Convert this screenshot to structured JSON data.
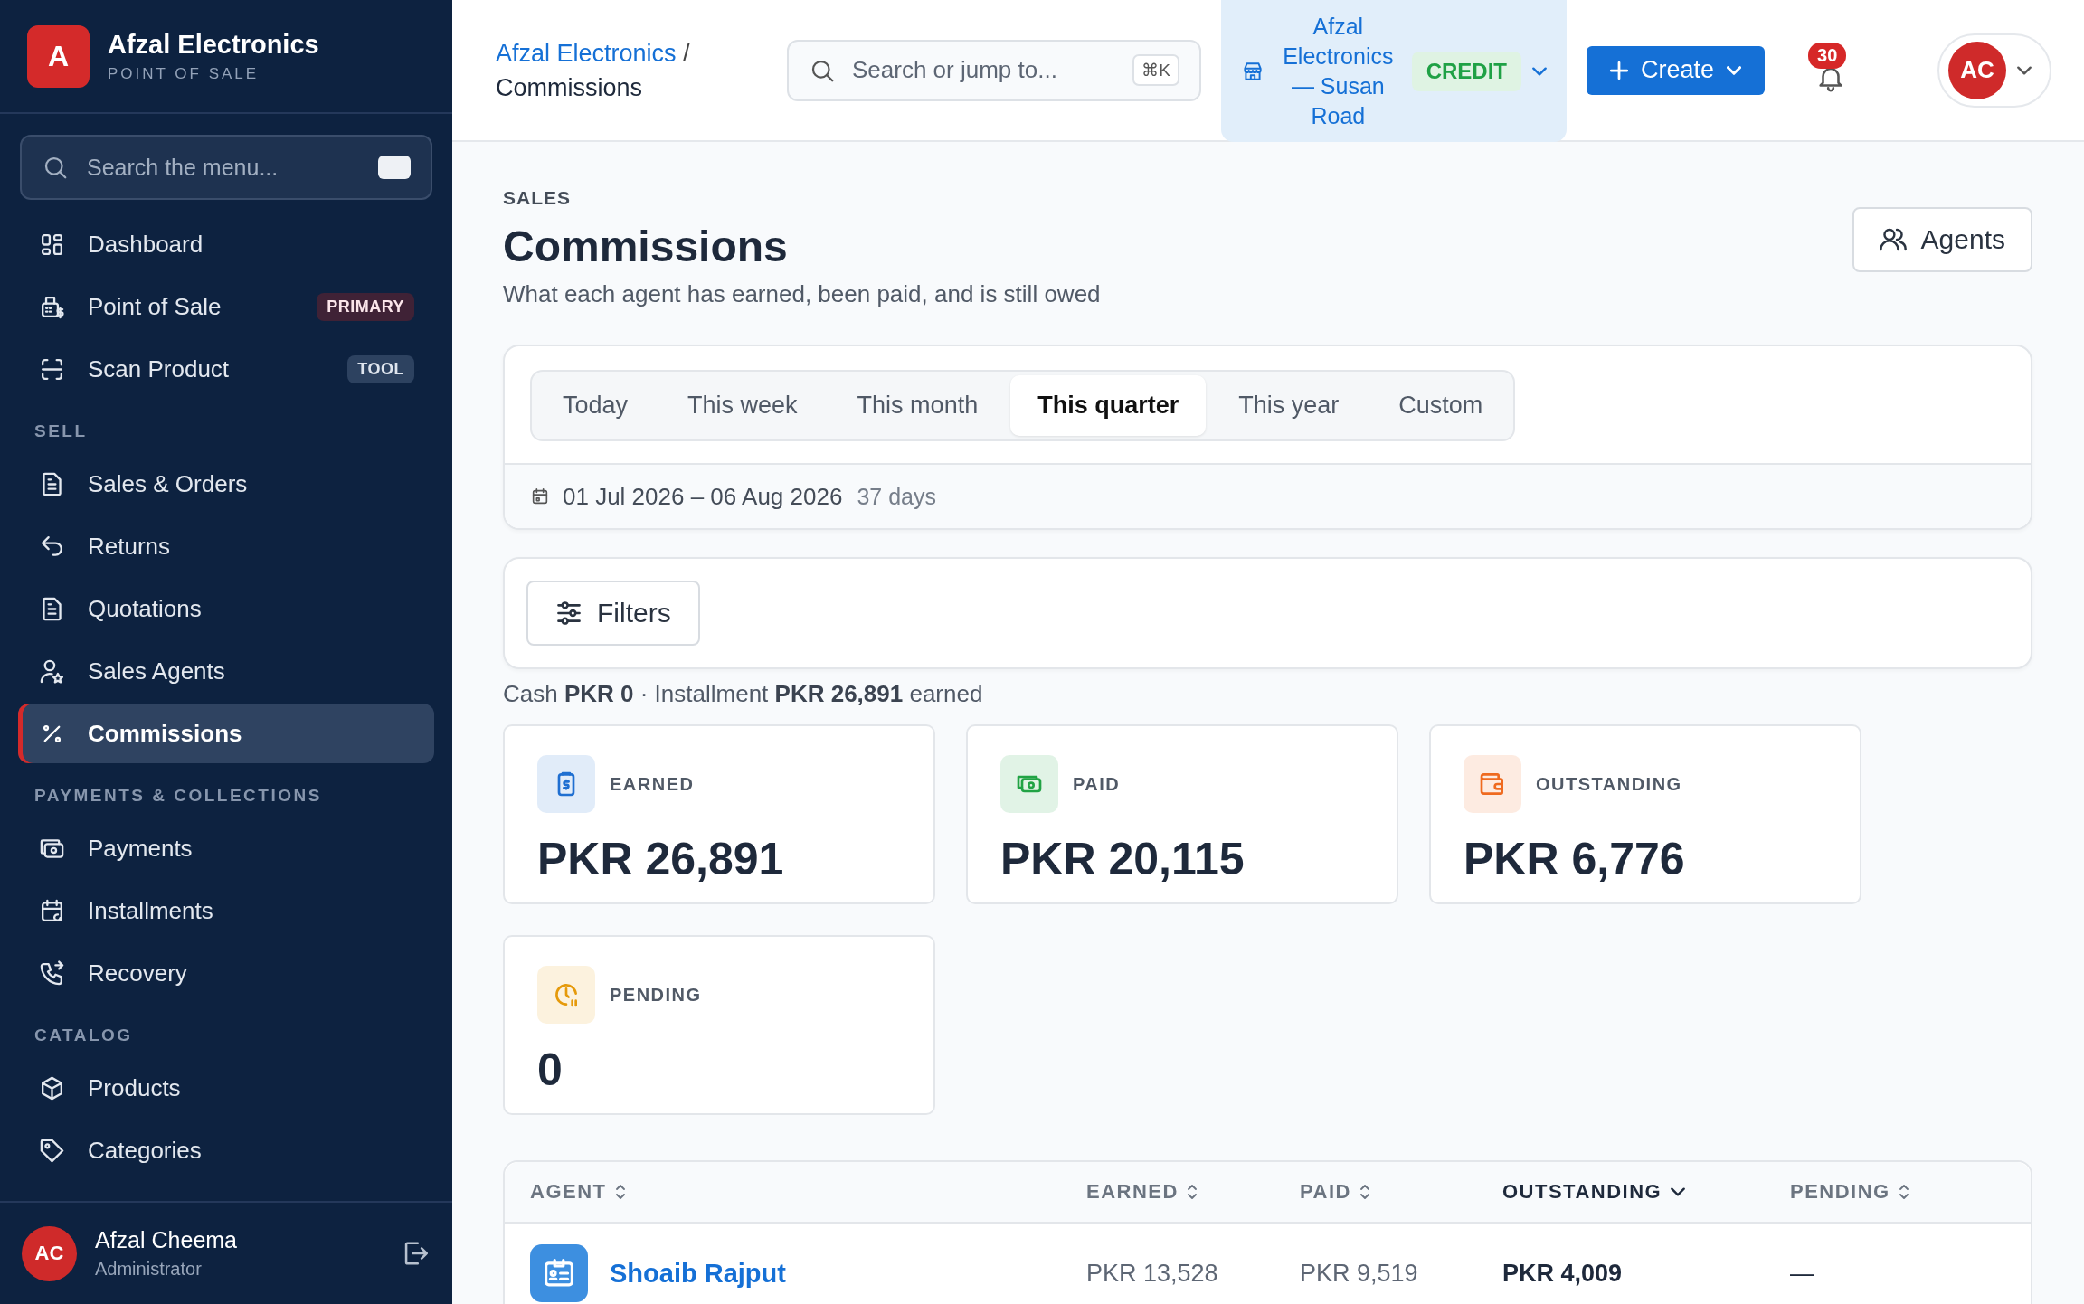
{
  "brand": {
    "initial": "A",
    "name": "Afzal Electronics",
    "tagline": "POINT OF SALE"
  },
  "menu_search": {
    "placeholder": "Search the menu..."
  },
  "sidebar": [
    {
      "items": [
        {
          "label": "Dashboard",
          "kind": "grid",
          "selected": false
        },
        {
          "label": "Point of Sale",
          "kind": "register",
          "selected": false,
          "badge": {
            "label": "PRIMARY",
            "kind": "primary"
          }
        },
        {
          "label": "Scan Product",
          "kind": "scan",
          "selected": false,
          "badge": {
            "label": "TOOL",
            "kind": "tool"
          }
        }
      ]
    },
    {
      "heading": "SELL",
      "items": [
        {
          "label": "Sales & Orders",
          "kind": "doc",
          "selected": false
        },
        {
          "label": "Returns",
          "kind": "return",
          "selected": false
        },
        {
          "label": "Quotations",
          "kind": "doc",
          "selected": false
        },
        {
          "label": "Sales Agents",
          "kind": "agent",
          "selected": false
        },
        {
          "label": "Commissions",
          "kind": "percent",
          "selected": true
        }
      ]
    },
    {
      "heading": "PAYMENTS & COLLECTIONS",
      "items": [
        {
          "label": "Payments",
          "kind": "cash",
          "selected": false
        },
        {
          "label": "Installments",
          "kind": "calendar",
          "selected": false
        },
        {
          "label": "Recovery",
          "kind": "phone",
          "selected": false
        }
      ]
    },
    {
      "heading": "CATALOG",
      "items": [
        {
          "label": "Products",
          "kind": "box",
          "selected": false
        },
        {
          "label": "Categories",
          "kind": "tag",
          "selected": false
        }
      ]
    }
  ],
  "user": {
    "initials": "AC",
    "name": "Afzal Cheema",
    "role": "Administrator"
  },
  "breadcrumb": {
    "parent": "Afzal Electronics",
    "separator": "/",
    "current": "Commissions"
  },
  "search": {
    "placeholder": "Search or jump to...",
    "shortcut": "⌘K"
  },
  "store": {
    "name": "Afzal Electronics — Susan Road",
    "badge": "CREDIT"
  },
  "create_button": "Create",
  "notifications": {
    "count": "30"
  },
  "avatar": "AC",
  "page": {
    "eyebrow": "SALES",
    "title": "Commissions",
    "subtitle": "What each agent has earned, been paid, and is still owed",
    "action": "Agents"
  },
  "period_tabs": [
    {
      "label": "Today",
      "selected": false
    },
    {
      "label": "This week",
      "selected": false
    },
    {
      "label": "This month",
      "selected": false
    },
    {
      "label": "This quarter",
      "selected": true
    },
    {
      "label": "This year",
      "selected": false
    },
    {
      "label": "Custom",
      "selected": false
    }
  ],
  "date_range": {
    "range": "01 Jul 2026 – 06 Aug 2026",
    "days": "37 days"
  },
  "filters_button": "Filters",
  "summary": "Cash **PKR 0** · Installment **PKR 26,891** earned",
  "stats": [
    {
      "kind": "earned",
      "label": "EARNED",
      "value": "PKR 26,891",
      "color": "#1f6fd1"
    },
    {
      "kind": "paid",
      "label": "PAID",
      "value": "PKR 20,115",
      "color": "#21a345"
    },
    {
      "kind": "outstanding",
      "label": "OUTSTANDING",
      "value": "PKR 6,776",
      "color": "#ef6a1f"
    },
    {
      "kind": "pending",
      "label": "PENDING",
      "value": "0",
      "color": "#e59a0b"
    }
  ],
  "table": {
    "columns": [
      {
        "label": "AGENT",
        "sorted": false
      },
      {
        "label": "EARNED",
        "sorted": false
      },
      {
        "label": "PAID",
        "sorted": false
      },
      {
        "label": "OUTSTANDING",
        "sorted": true
      },
      {
        "label": "PENDING",
        "sorted": false
      }
    ],
    "rows": [
      {
        "agent": "Shoaib Rajput",
        "earned": "PKR 13,528",
        "paid": "PKR 9,519",
        "outstanding": "PKR 4,009",
        "pending": "—"
      }
    ]
  }
}
